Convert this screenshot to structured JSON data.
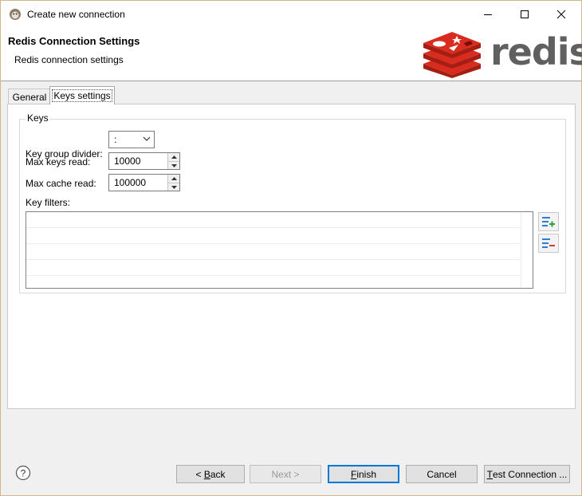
{
  "window": {
    "title": "Create new connection",
    "controls": {
      "minimize": "minimize-icon",
      "maximize": "maximize-icon",
      "close": "close-icon"
    }
  },
  "header": {
    "title": "Redis Connection Settings",
    "subtitle": "Redis connection settings",
    "logo_text": "redis"
  },
  "tabs": [
    {
      "label": "General",
      "selected": false
    },
    {
      "label": "Keys settings",
      "selected": true
    }
  ],
  "keys": {
    "group_label": "Keys",
    "key_group_divider_label": "Key group divider:",
    "key_group_divider_value": ":",
    "max_keys_read_label": "Max keys read:",
    "max_keys_read_value": "10000",
    "max_cache_read_label": "Max cache read:",
    "max_cache_read_value": "100000",
    "key_filters_label": "Key filters:",
    "key_filters": []
  },
  "footer": {
    "back_mnemonic": "B",
    "back_rest": "ack",
    "back_prefix": "< ",
    "next_label": "Next >",
    "finish_mnemonic": "F",
    "finish_rest": "inish",
    "cancel_label": "Cancel",
    "test_mnemonic": "T",
    "test_rest": "est Connection ..."
  },
  "colors": {
    "accent": "#0078d7",
    "redis_red": "#d82c20",
    "redis_gray": "#606060",
    "add_green": "#2e9e3e",
    "remove_red": "#d9392d",
    "list_blue": "#2a7fd4"
  }
}
